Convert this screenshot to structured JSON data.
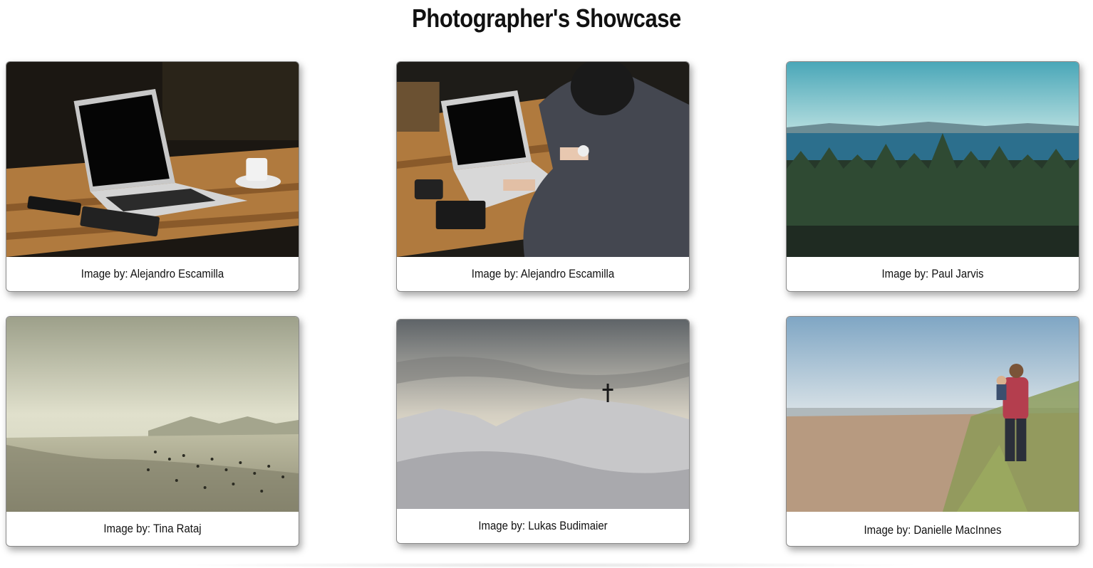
{
  "header": {
    "title": "Photographer's Showcase"
  },
  "gallery": [
    {
      "credit": "Image by: Alejandro Escamilla",
      "subject": "laptop-on-table"
    },
    {
      "credit": "Image by: Alejandro Escamilla",
      "subject": "person-typing-laptop"
    },
    {
      "credit": "Image by: Paul Jarvis",
      "subject": "forest-and-sea"
    },
    {
      "credit": "Image by: Tina Rataj",
      "subject": "beach-crowd"
    },
    {
      "credit": "Image by: Lukas Budimaier",
      "subject": "snowy-hill-cross"
    },
    {
      "credit": "Image by: Danielle MacInnes",
      "subject": "man-carrying-child-beach"
    }
  ]
}
